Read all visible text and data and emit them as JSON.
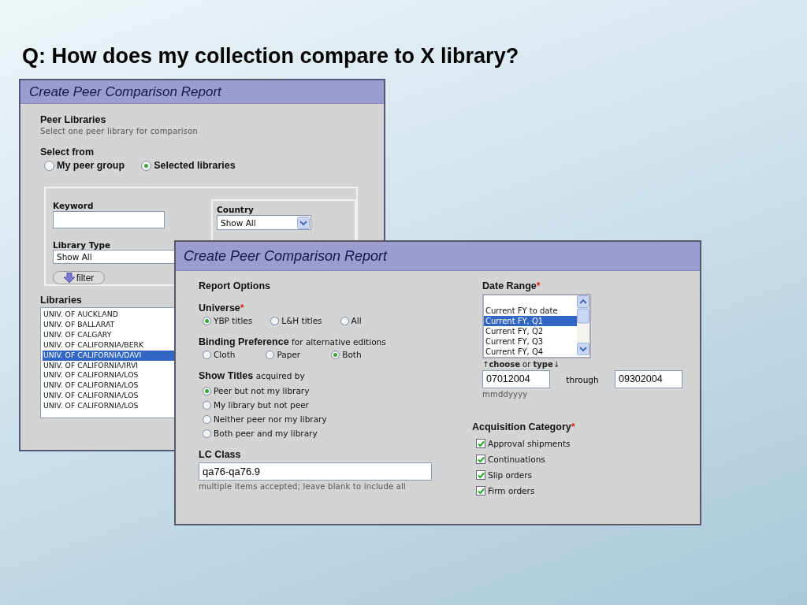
{
  "slide_title": "Q: How does my collection compare to X library?",
  "back_window": {
    "title": "Create Peer Comparison Report",
    "peer_libraries": {
      "heading": "Peer Libraries",
      "hint": "Select one peer library for comparison"
    },
    "select_from": {
      "label": "Select from",
      "options": [
        {
          "label": "My peer group",
          "selected": false
        },
        {
          "label": "Selected libraries",
          "selected": true
        }
      ]
    },
    "keyword": {
      "label": "Keyword"
    },
    "country": {
      "label": "Country",
      "value": "Show All"
    },
    "library_type": {
      "label": "Library Type",
      "value": "Show All"
    },
    "filter_button": "filter",
    "libraries": {
      "label": "Libraries",
      "items": [
        {
          "name": "UNIV. OF AUCKLAND",
          "selected": false
        },
        {
          "name": "UNIV. OF BALLARAT",
          "selected": false
        },
        {
          "name": "UNIV. OF CALGARY",
          "selected": false
        },
        {
          "name": "UNIV. OF CALIFORNIA/BERK",
          "selected": false
        },
        {
          "name": "UNIV. OF CALIFORNIA/DAVI",
          "selected": true
        },
        {
          "name": "UNIV. OF CALIFORNIA/IRVI",
          "selected": false
        },
        {
          "name": "UNIV. OF CALIFORNIA/LOS",
          "selected": false
        },
        {
          "name": "UNIV. OF CALIFORNIA/LOS",
          "selected": false
        },
        {
          "name": "UNIV. OF CALIFORNIA/LOS",
          "selected": false
        },
        {
          "name": "UNIV. OF CALIFORNIA/LOS",
          "selected": false
        }
      ]
    }
  },
  "front_window": {
    "title": "Create Peer Comparison Report",
    "report_options": "Report Options",
    "universe": {
      "label": "Universe",
      "required_mark": "*",
      "options": [
        {
          "label": "YBP titles",
          "selected": true
        },
        {
          "label": "L&H titles",
          "selected": false
        },
        {
          "label": "All",
          "selected": false
        }
      ]
    },
    "binding": {
      "label": "Binding Preference",
      "note": "for alternative editions",
      "options": [
        {
          "label": "Cloth",
          "selected": false
        },
        {
          "label": "Paper",
          "selected": false
        },
        {
          "label": "Both",
          "selected": true
        }
      ]
    },
    "show_titles": {
      "label": "Show Titles",
      "note": "acquired by",
      "options": [
        {
          "label": "Peer but not my library",
          "selected": true
        },
        {
          "label": "My library but not peer",
          "selected": false
        },
        {
          "label": "Neither peer nor my library",
          "selected": false
        },
        {
          "label": "Both peer and my library",
          "selected": false
        }
      ]
    },
    "lc_class": {
      "label": "LC Class",
      "value": "qa76-qa76.9",
      "hint": "multiple items accepted; leave blank to include all"
    },
    "date_range": {
      "label": "Date Range",
      "required_mark": "*",
      "options": [
        {
          "label": "Current FY to date",
          "selected": false
        },
        {
          "label": "Current FY, Q1",
          "selected": true
        },
        {
          "label": "Current FY, Q2",
          "selected": false
        },
        {
          "label": "Current FY, Q3",
          "selected": false
        },
        {
          "label": "Current FY, Q4",
          "selected": false
        }
      ],
      "choose_hint": "↑**choose** or **type**↓",
      "from": "07012004",
      "through": "through",
      "to": "09302004",
      "format": "mmddyyyy"
    },
    "acquisition": {
      "label": "Acquisition Category",
      "required_mark": "*",
      "items": [
        {
          "label": "Approval shipments",
          "checked": true
        },
        {
          "label": "Continuations",
          "checked": true
        },
        {
          "label": "Slip orders",
          "checked": true
        },
        {
          "label": "Firm orders",
          "checked": true
        }
      ]
    }
  }
}
